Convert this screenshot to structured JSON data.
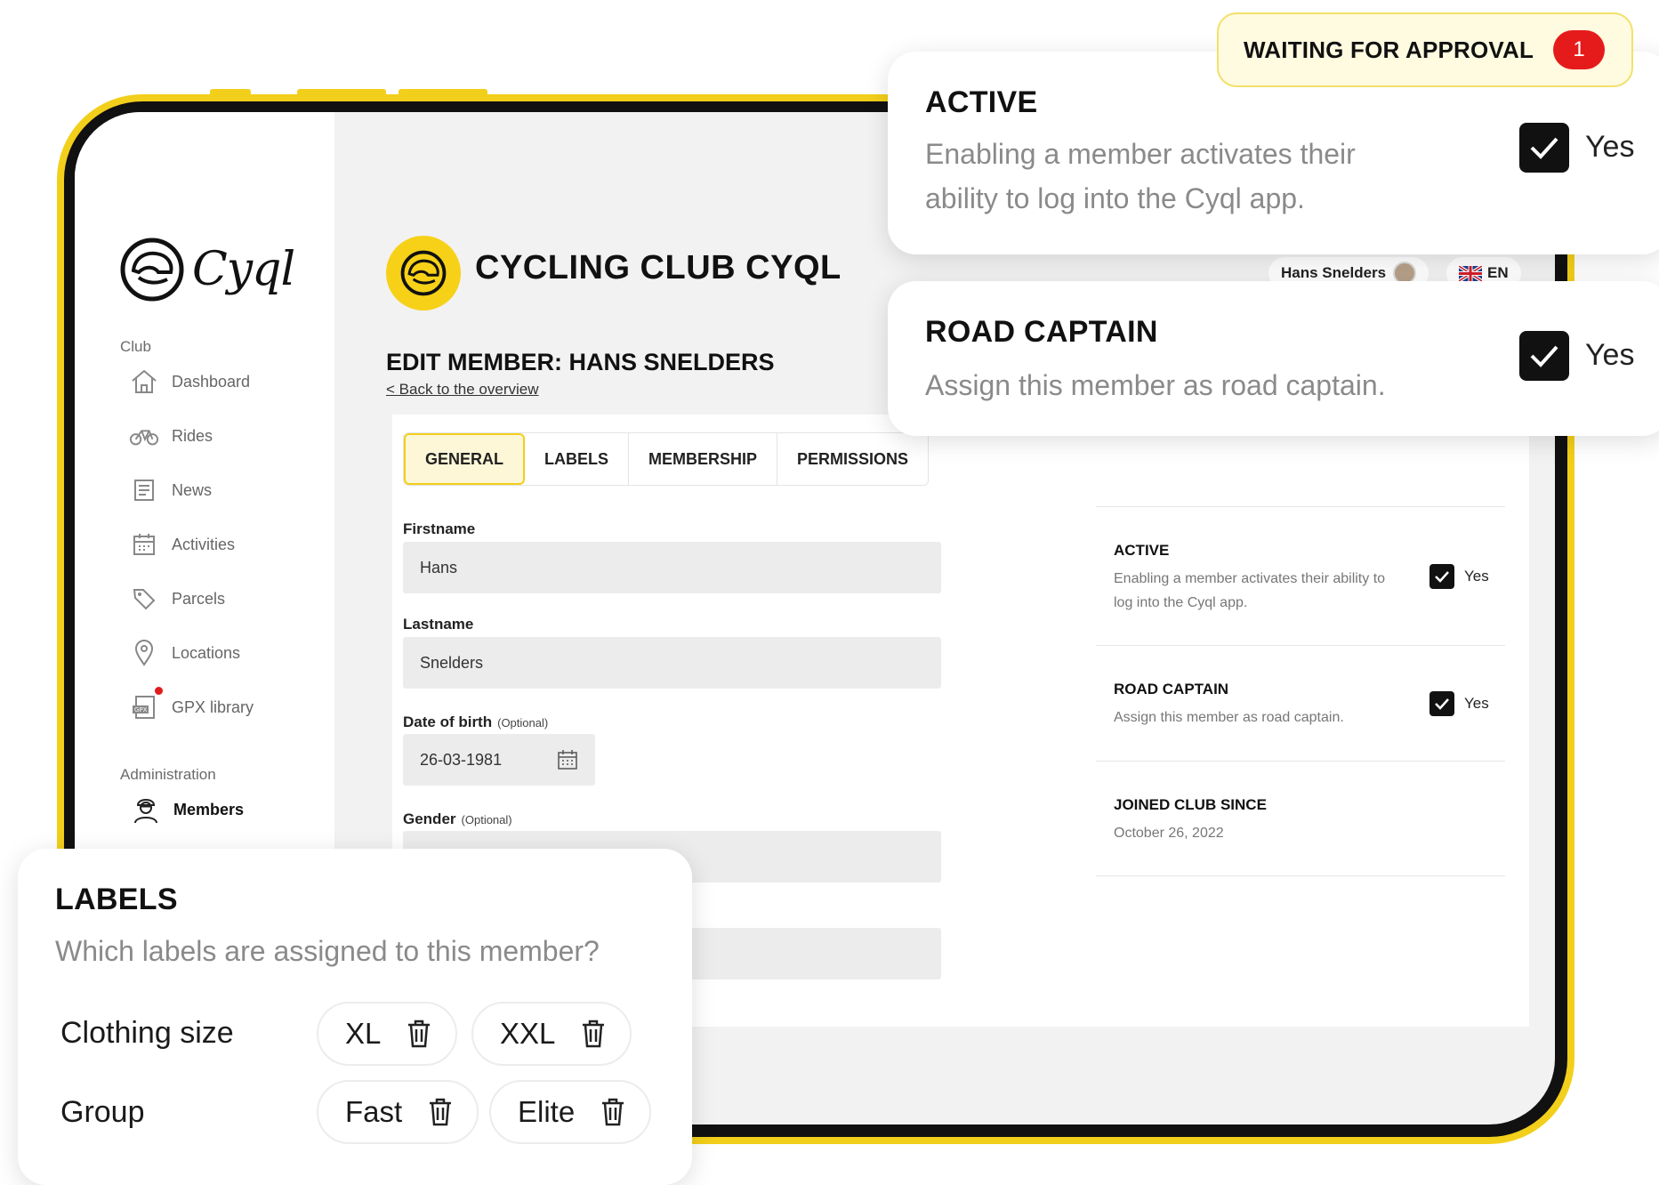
{
  "app": {
    "logo_text": "Cyql"
  },
  "sidebar": {
    "section_club": "Club",
    "items": [
      {
        "label": "Dashboard",
        "icon": "home-icon"
      },
      {
        "label": "Rides",
        "icon": "bike-icon"
      },
      {
        "label": "News",
        "icon": "newspaper-icon"
      },
      {
        "label": "Activities",
        "icon": "calendar-icon"
      },
      {
        "label": "Parcels",
        "icon": "tag-icon"
      },
      {
        "label": "Locations",
        "icon": "location-pin-icon"
      },
      {
        "label": "GPX library",
        "icon": "gpx-file-icon",
        "has_notification_dot": true
      }
    ],
    "section_admin": "Administration",
    "admin_items": [
      {
        "label": "Members",
        "icon": "cyclist-icon",
        "active": true
      }
    ]
  },
  "header": {
    "club_name": "CYCLING CLUB CYQL",
    "user_name": "Hans Snelders",
    "language": "EN"
  },
  "page": {
    "title": "EDIT MEMBER: HANS SNELDERS",
    "back_link": "< Back to the overview"
  },
  "tabs": [
    {
      "label": "GENERAL",
      "active": true
    },
    {
      "label": "LABELS",
      "active": false
    },
    {
      "label": "MEMBERSHIP",
      "active": false
    },
    {
      "label": "PERMISSIONS",
      "active": false
    }
  ],
  "form": {
    "firstname": {
      "label": "Firstname",
      "value": "Hans"
    },
    "lastname": {
      "label": "Lastname",
      "value": "Snelders"
    },
    "dob": {
      "label": "Date of birth",
      "optional": "(Optional)",
      "value": "26-03-1981"
    },
    "gender": {
      "label": "Gender",
      "optional": "(Optional)",
      "value": ""
    }
  },
  "right_panel": {
    "active": {
      "title": "ACTIVE",
      "desc": "Enabling a member activates their ability to log into the Cyql app.",
      "checked": true,
      "yes": "Yes"
    },
    "road_captain": {
      "title": "ROAD CAPTAIN",
      "desc": "Assign this member as road captain.",
      "checked": true,
      "yes": "Yes"
    },
    "joined": {
      "title": "JOINED CLUB SINCE",
      "value": "October 26, 2022"
    }
  },
  "overlay_approval": {
    "text": "WAITING FOR APPROVAL",
    "count": "1"
  },
  "overlay_active": {
    "title": "ACTIVE",
    "desc": "Enabling a member activates their ability to log into the Cyql app.",
    "yes": "Yes"
  },
  "overlay_road_captain": {
    "title": "ROAD CAPTAIN",
    "desc": "Assign this member as road captain.",
    "yes": "Yes"
  },
  "overlay_labels": {
    "title": "LABELS",
    "question": "Which labels are assigned to this member?",
    "rows": [
      {
        "name": "Clothing size",
        "labels": [
          "XL",
          "XXL"
        ]
      },
      {
        "name": "Group",
        "labels": [
          "Fast",
          "Elite"
        ]
      }
    ]
  },
  "colors": {
    "accent": "#f2cf1b",
    "badge": "#e51b1b",
    "frame": "#111111"
  }
}
